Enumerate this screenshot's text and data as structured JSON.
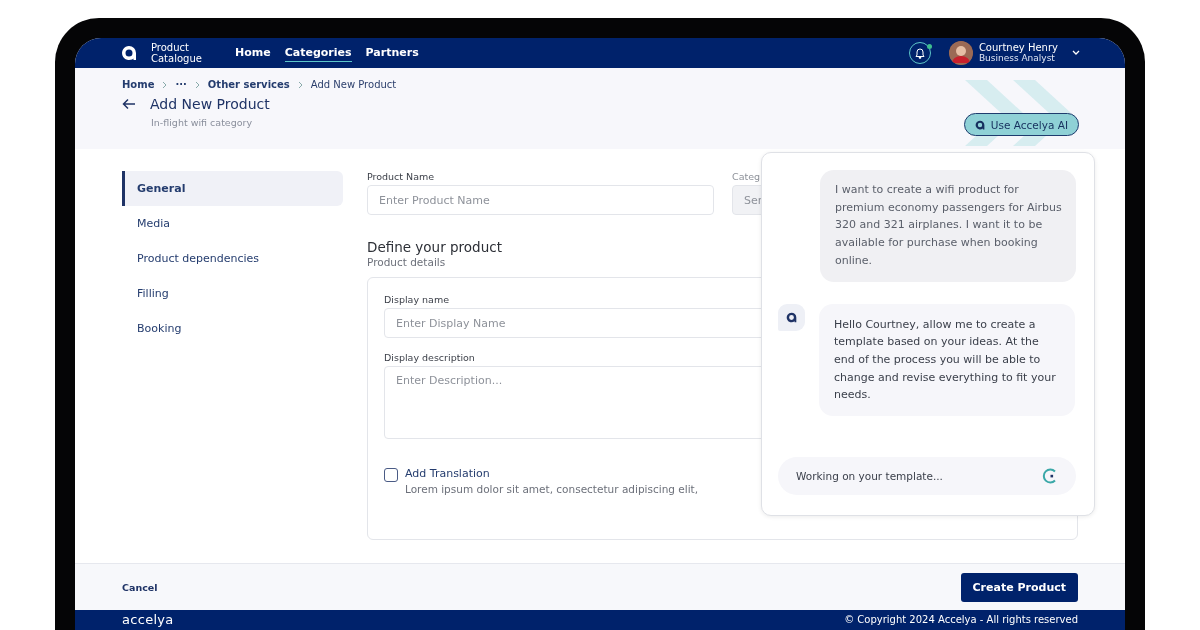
{
  "nav": {
    "app_name": "Product Catalogue",
    "links": [
      {
        "label": "Home",
        "selected": false
      },
      {
        "label": "Categories",
        "selected": true
      },
      {
        "label": "Partners",
        "selected": false
      }
    ],
    "notifications": {
      "unread": true
    },
    "user": {
      "name": "Courtney Henry",
      "role": "Business Analyst"
    }
  },
  "breadcrumb": [
    "Home",
    "···",
    "Other services",
    "Add New Product"
  ],
  "page": {
    "title": "Add New Product",
    "subtitle": "In-flight wifi category",
    "ai_button": "Use Accelya AI"
  },
  "sections": [
    {
      "label": "General",
      "selected": true
    },
    {
      "label": "Media",
      "selected": false
    },
    {
      "label": "Product dependencies",
      "selected": false
    },
    {
      "label": "Filling",
      "selected": false
    },
    {
      "label": "Booking",
      "selected": false
    }
  ],
  "form": {
    "product_name": {
      "label": "Product Name",
      "placeholder": "Enter Product Name"
    },
    "category": {
      "label": "Categ",
      "value": "Ser"
    },
    "section_title": "Define your product",
    "section_subtitle": "Product details",
    "display_name": {
      "label": "Display name",
      "placeholder": "Enter Display Name"
    },
    "display_description": {
      "label": "Display description",
      "placeholder": "Enter Description..."
    },
    "translation": {
      "label": "Add Translation",
      "checked": false,
      "description": "Lorem ipsum dolor sit amet, consectetur adipiscing elit,"
    }
  },
  "chat": {
    "messages": [
      {
        "kind": "user",
        "text": "I want to create a wifi product for premium economy passengers for Airbus 320 and 321 airplanes. I want it to be available for purchase when booking online."
      },
      {
        "kind": "assistant",
        "text": "Hello Courtney, allow me to create a template based on your ideas. At the end of the process you will be able to change and revise everything to fit your needs."
      }
    ],
    "status": "Working on your template..."
  },
  "actions": {
    "cancel": "Cancel",
    "create": "Create Product"
  },
  "footer": {
    "brand": "accelya",
    "copyright": "© Copyright 2024 Accelya - All rights reserved"
  }
}
